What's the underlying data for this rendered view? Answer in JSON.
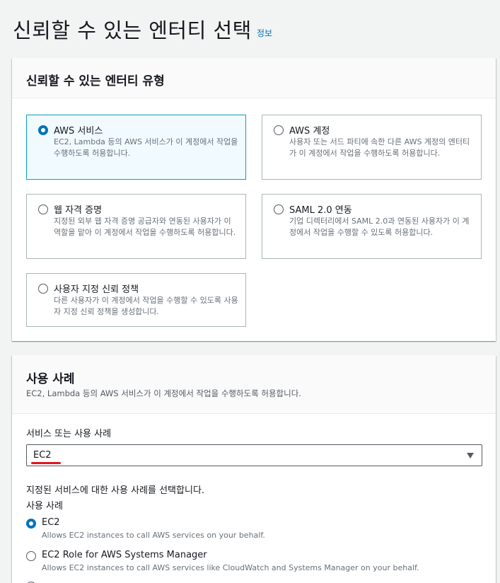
{
  "page": {
    "title": "신뢰할 수 있는 엔터티 선택",
    "info_link": "정보"
  },
  "entity_type": {
    "title": "신뢰할 수 있는 엔터티 유형",
    "options": [
      {
        "label": "AWS 서비스",
        "description": "EC2, Lambda 등의 AWS 서비스가 이 계정에서 작업을 수행하도록 허용합니다.",
        "selected": true
      },
      {
        "label": "AWS 계정",
        "description": "사용자 또는 서드 파티에 속한 다른 AWS 계정의 엔터티가 이 계정에서 작업을 수행하도록 허용합니다.",
        "selected": false
      },
      {
        "label": "웹 자격 증명",
        "description": "지정된 외부 웹 자격 증명 공급자와 연동된 사용자가 이 역할을 맡아 이 계정에서 작업을 수행하도록 허용합니다.",
        "selected": false
      },
      {
        "label": "SAML 2.0 연동",
        "description": "기업 디렉터리에서 SAML 2.0과 연동된 사용자가 이 계정에서 작업을 수행할 수 있도록 허용합니다.",
        "selected": false
      },
      {
        "label": "사용자 지정 신뢰 정책",
        "description": "다른 사용자가 이 계정에서 작업을 수행할 수 있도록 사용자 지정 신뢰 정책을 생성합니다.",
        "selected": false
      }
    ]
  },
  "use_case": {
    "title": "사용 사례",
    "description": "EC2, Lambda 등의 AWS 서비스가 이 계정에서 작업을 수행하도록 허용합니다.",
    "field_label": "서비스 또는 사용 사례",
    "selected_value": "EC2",
    "hint": "지정된 서비스에 대한 사용 사례를 선택합니다.",
    "sublabel": "사용 사례",
    "options": [
      {
        "label": "EC2",
        "description": "Allows EC2 instances to call AWS services on your behalf.",
        "selected": true
      },
      {
        "label": "EC2 Role for AWS Systems Manager",
        "description": "Allows EC2 instances to call AWS services like CloudWatch and Systems Manager on your behalf.",
        "selected": false
      }
    ]
  },
  "colors": {
    "accent": "#0073bb",
    "selected_border": "#00a1c9",
    "selected_bg": "#f1faff",
    "annotation_underline": "#e0161f"
  }
}
